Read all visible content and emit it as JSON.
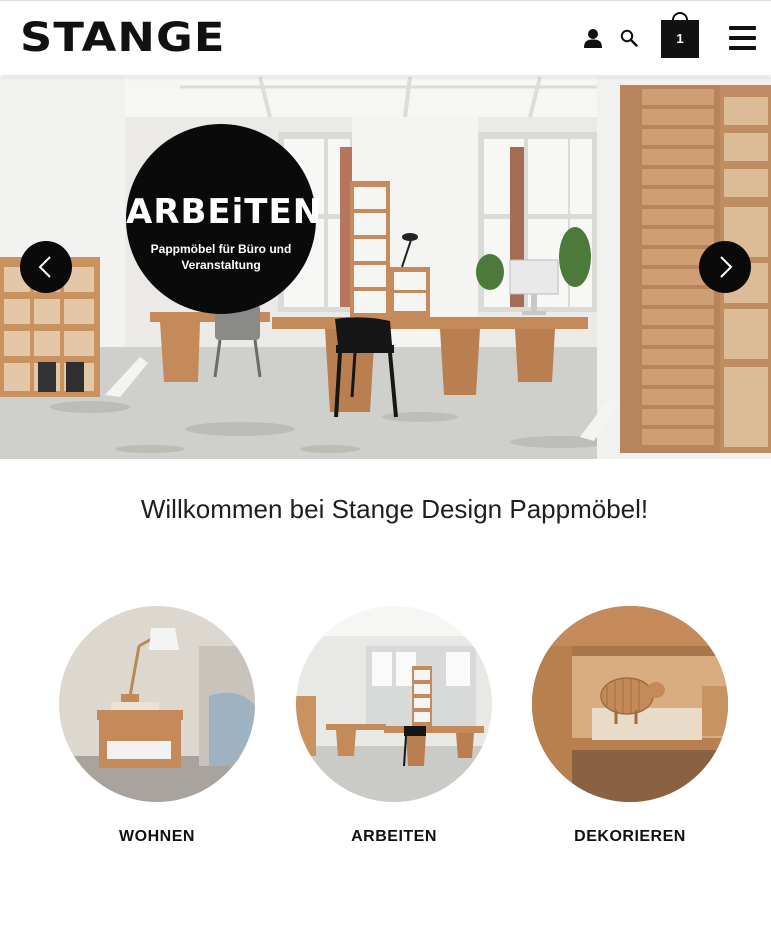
{
  "header": {
    "logo_text": "STANGE",
    "cart_count": "1",
    "icons": [
      "user-icon",
      "search-icon",
      "cart-icon",
      "menu-icon"
    ]
  },
  "hero": {
    "badge_title": "ARBEiTEN",
    "badge_subtitle": "Pappmöbel für Büro und Veranstaltung",
    "prev_icon": "chevron-left-icon",
    "next_icon": "chevron-right-icon"
  },
  "welcome": {
    "heading": "Willkommen bei Stange Design Pappmöbel!"
  },
  "categories": [
    {
      "label": "WOHNEN"
    },
    {
      "label": "ARBEITEN"
    },
    {
      "label": "DEKORIEREN"
    }
  ],
  "colors": {
    "black": "#0a0a0a",
    "cardboard": "#c48a5a",
    "background": "#ffffff"
  }
}
